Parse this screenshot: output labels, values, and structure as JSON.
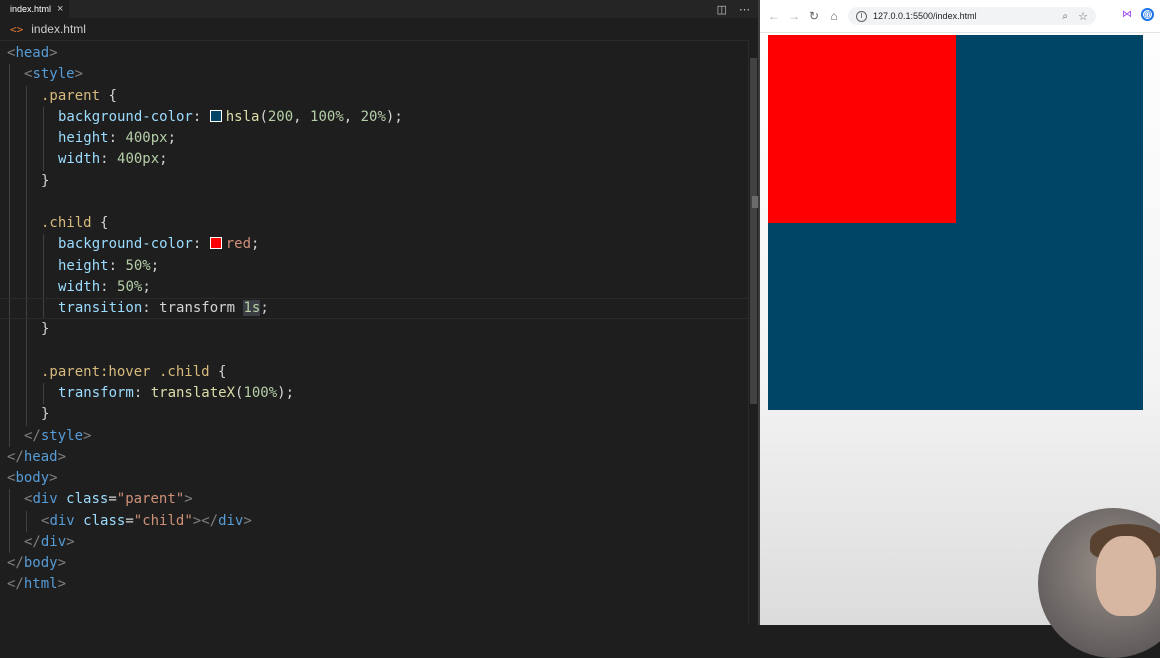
{
  "editor": {
    "tab": {
      "label": "index.html",
      "close": "×"
    },
    "breadcrumb": {
      "file": "index.html"
    },
    "actions": {
      "split": "◫",
      "more": "⋯"
    },
    "code_lines": [
      {
        "indent": 0,
        "tokens": [
          [
            "br",
            "<"
          ],
          [
            "tag",
            "head"
          ],
          [
            "br",
            ">"
          ]
        ]
      },
      {
        "indent": 1,
        "tokens": [
          [
            "br",
            "<"
          ],
          [
            "tag",
            "style"
          ],
          [
            "br",
            ">"
          ]
        ]
      },
      {
        "indent": 2,
        "tokens": [
          [
            "sel",
            ".parent"
          ],
          [
            "txt",
            " {"
          ]
        ]
      },
      {
        "indent": 3,
        "tokens": [
          [
            "prop",
            "background-color"
          ],
          [
            "txt",
            ": "
          ],
          [
            "swatch",
            "#004466"
          ],
          [
            "fn",
            "hsla"
          ],
          [
            "txt",
            "("
          ],
          [
            "num",
            "200"
          ],
          [
            "txt",
            ", "
          ],
          [
            "num",
            "100%"
          ],
          [
            "txt",
            ", "
          ],
          [
            "num",
            "20%"
          ],
          [
            "txt",
            ");"
          ]
        ]
      },
      {
        "indent": 3,
        "tokens": [
          [
            "prop",
            "height"
          ],
          [
            "txt",
            ": "
          ],
          [
            "num",
            "400px"
          ],
          [
            "txt",
            ";"
          ]
        ]
      },
      {
        "indent": 3,
        "tokens": [
          [
            "prop",
            "width"
          ],
          [
            "txt",
            ": "
          ],
          [
            "num",
            "400px"
          ],
          [
            "txt",
            ";"
          ]
        ]
      },
      {
        "indent": 2,
        "tokens": [
          [
            "txt",
            "}"
          ]
        ]
      },
      {
        "indent": 2,
        "tokens": []
      },
      {
        "indent": 2,
        "tokens": [
          [
            "sel",
            ".child"
          ],
          [
            "txt",
            " {"
          ]
        ]
      },
      {
        "indent": 3,
        "tokens": [
          [
            "prop",
            "background-color"
          ],
          [
            "txt",
            ": "
          ],
          [
            "swatch",
            "#ff0000"
          ],
          [
            "str",
            "red"
          ],
          [
            "txt",
            ";"
          ]
        ]
      },
      {
        "indent": 3,
        "tokens": [
          [
            "prop",
            "height"
          ],
          [
            "txt",
            ": "
          ],
          [
            "num",
            "50%"
          ],
          [
            "txt",
            ";"
          ]
        ]
      },
      {
        "indent": 3,
        "tokens": [
          [
            "prop",
            "width"
          ],
          [
            "txt",
            ": "
          ],
          [
            "num",
            "50%"
          ],
          [
            "txt",
            ";"
          ]
        ]
      },
      {
        "indent": 3,
        "current": true,
        "tokens": [
          [
            "prop",
            "transition"
          ],
          [
            "txt",
            ": transform "
          ],
          [
            "hl",
            "1s"
          ],
          [
            "txt",
            ";"
          ]
        ]
      },
      {
        "indent": 2,
        "tokens": [
          [
            "txt",
            "}"
          ]
        ]
      },
      {
        "indent": 2,
        "tokens": []
      },
      {
        "indent": 2,
        "tokens": [
          [
            "sel",
            ".parent:hover .child"
          ],
          [
            "txt",
            " {"
          ]
        ]
      },
      {
        "indent": 3,
        "tokens": [
          [
            "prop",
            "transform"
          ],
          [
            "txt",
            ": "
          ],
          [
            "fn",
            "translateX"
          ],
          [
            "txt",
            "("
          ],
          [
            "num",
            "100%"
          ],
          [
            "txt",
            ");"
          ]
        ]
      },
      {
        "indent": 2,
        "tokens": [
          [
            "txt",
            "}"
          ]
        ]
      },
      {
        "indent": 1,
        "tokens": [
          [
            "br",
            "</"
          ],
          [
            "tag",
            "style"
          ],
          [
            "br",
            ">"
          ]
        ]
      },
      {
        "indent": 0,
        "tokens": [
          [
            "br",
            "</"
          ],
          [
            "tag",
            "head"
          ],
          [
            "br",
            ">"
          ]
        ]
      },
      {
        "indent": 0,
        "tokens": [
          [
            "br",
            "<"
          ],
          [
            "tag",
            "body"
          ],
          [
            "br",
            ">"
          ]
        ]
      },
      {
        "indent": 1,
        "tokens": [
          [
            "br",
            "<"
          ],
          [
            "tag",
            "div"
          ],
          [
            "txt",
            " "
          ],
          [
            "attr",
            "class"
          ],
          [
            "txt",
            "="
          ],
          [
            "str",
            "\"parent\""
          ],
          [
            "br",
            ">"
          ]
        ]
      },
      {
        "indent": 2,
        "tokens": [
          [
            "br",
            "<"
          ],
          [
            "tag",
            "div"
          ],
          [
            "txt",
            " "
          ],
          [
            "attr",
            "class"
          ],
          [
            "txt",
            "="
          ],
          [
            "str",
            "\"child\""
          ],
          [
            "br",
            "></"
          ],
          [
            "tag",
            "div"
          ],
          [
            "br",
            ">"
          ]
        ]
      },
      {
        "indent": 1,
        "tokens": [
          [
            "br",
            "</"
          ],
          [
            "tag",
            "div"
          ],
          [
            "br",
            ">"
          ]
        ]
      },
      {
        "indent": 0,
        "tokens": [
          [
            "br",
            "</"
          ],
          [
            "tag",
            "body"
          ],
          [
            "br",
            ">"
          ]
        ]
      },
      {
        "indent": 0,
        "tokens": [
          [
            "br",
            "</"
          ],
          [
            "tag",
            "html"
          ],
          [
            "br",
            ">"
          ]
        ]
      }
    ]
  },
  "browser": {
    "url": "127.0.0.1:5500/index.html",
    "icons": {
      "back": "←",
      "forward": "→",
      "reload": "↻",
      "home": "⌂",
      "info": "i",
      "zoom": "⌕",
      "star": "☆",
      "extension": "⋈",
      "profile": "@"
    },
    "page": {
      "parent_color": "#004466",
      "child_color": "#ff0000"
    }
  }
}
